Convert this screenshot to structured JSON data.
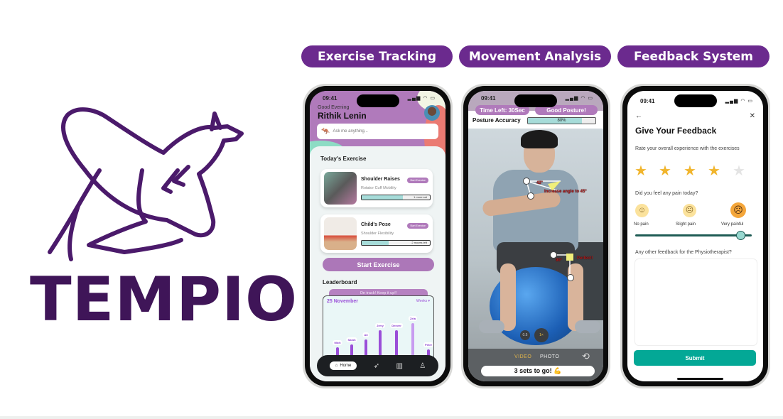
{
  "brand": {
    "name": "TEMPIO",
    "purple": "#3f1558"
  },
  "features": [
    "Exercise Tracking",
    "Movement Analysis",
    "Feedback System"
  ],
  "status_time": "09:41",
  "home": {
    "greeting": "Good Evening",
    "user": "Rithik Lenin",
    "ask_placeholder": "Ask me anything...",
    "section": "Today's Exercise",
    "exercises": [
      {
        "title": "Shoulder Raises",
        "subtitle": "Rotator Cuff Mobility",
        "button": "Start Exercise",
        "progress": 0.6,
        "progress_label": "1 more set"
      },
      {
        "title": "Child's Pose",
        "subtitle": "Shoulder Flexibility",
        "button": "Start Exercise",
        "progress": 0.4,
        "progress_label": "2 moves left"
      }
    ],
    "start_button": "Start Exercise",
    "leaderboard": {
      "title": "Leaderboard",
      "banner": "On track! Keep it up!!",
      "date": "25 November",
      "period": "Weeks ▾",
      "entries": [
        {
          "name": "Mich",
          "value": 0.45
        },
        {
          "name": "Sarah",
          "value": 0.52
        },
        {
          "name": "Ali",
          "value": 0.63
        },
        {
          "name": "Jerry",
          "value": 0.84
        },
        {
          "name": "Denver",
          "value": 0.84
        },
        {
          "name": "Zela",
          "value": 1.0
        },
        {
          "name": "Peter",
          "value": 0.4
        }
      ]
    },
    "nav": [
      "Home"
    ]
  },
  "movement": {
    "time_left": "Time Left: 30Sec",
    "posture_status": "Good Posture!",
    "accuracy_label": "Posture Accuracy",
    "accuracy": 80,
    "accuracy_text": "80%",
    "annotations": {
      "elbow_angle": "42°",
      "elbow_hint": "Increase angle to 45°",
      "knee_angle": "90°",
      "knee_hint": "Perfect!"
    },
    "zoom_options": [
      "0.5",
      "1×"
    ],
    "modes": [
      "VIDEO",
      "PHOTO"
    ],
    "sets_text": "3 sets to go! 💪"
  },
  "feedback": {
    "title": "Give Your Feedback",
    "rating_question": "Rate your overall experience with the exercises",
    "rating": 4,
    "rating_max": 5,
    "pain_question": "Did you feel any pain today?",
    "pain_labels": [
      "No pain",
      "Slight pain",
      "Very painful"
    ],
    "pain_level": 0.9,
    "other_question": "Any other feedback for the Physiotherapist?",
    "submit": "Submit"
  }
}
